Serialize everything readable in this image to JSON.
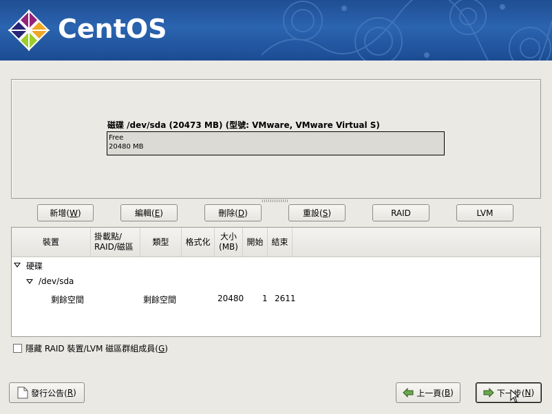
{
  "banner": {
    "brand": "CentOS"
  },
  "disk": {
    "title": "磁碟 /dev/sda (20473 MB) (型號: VMware, VMware Virtual S)",
    "segment_label": "Free",
    "segment_size": "20480 MB"
  },
  "actions": {
    "new": {
      "label": "新增(",
      "mnemonic": "W",
      "close": ")"
    },
    "edit": {
      "label": "編輯(",
      "mnemonic": "E",
      "close": ")"
    },
    "delete": {
      "label": "刪除(",
      "mnemonic": "D",
      "close": ")"
    },
    "reset": {
      "label": "重設(",
      "mnemonic": "S",
      "close": ")"
    },
    "raid": {
      "label": "RAID"
    },
    "lvm": {
      "label": "LVM"
    }
  },
  "table": {
    "headers": [
      "裝置",
      "掛載點/\nRAID/磁區",
      "類型",
      "格式化",
      "大小\n(MB)",
      "開始",
      "結束"
    ],
    "tree": {
      "root": "硬碟",
      "device": "/dev/sda",
      "row": {
        "device": "剩餘空間",
        "type": "剩餘空間",
        "size": "20480",
        "start": "1",
        "end": "2611"
      }
    }
  },
  "hide_members": {
    "label": "隱藏 RAID 裝置/LVM 磁區群組成員(",
    "mnemonic": "G",
    "close": ")"
  },
  "footer": {
    "release_notes": {
      "label": "發行公告(",
      "mnemonic": "R",
      "close": ")"
    },
    "back": {
      "label": "上一頁(",
      "mnemonic": "B",
      "close": ")"
    },
    "next": {
      "label": "下一步(",
      "mnemonic": "N",
      "close": ")"
    }
  }
}
